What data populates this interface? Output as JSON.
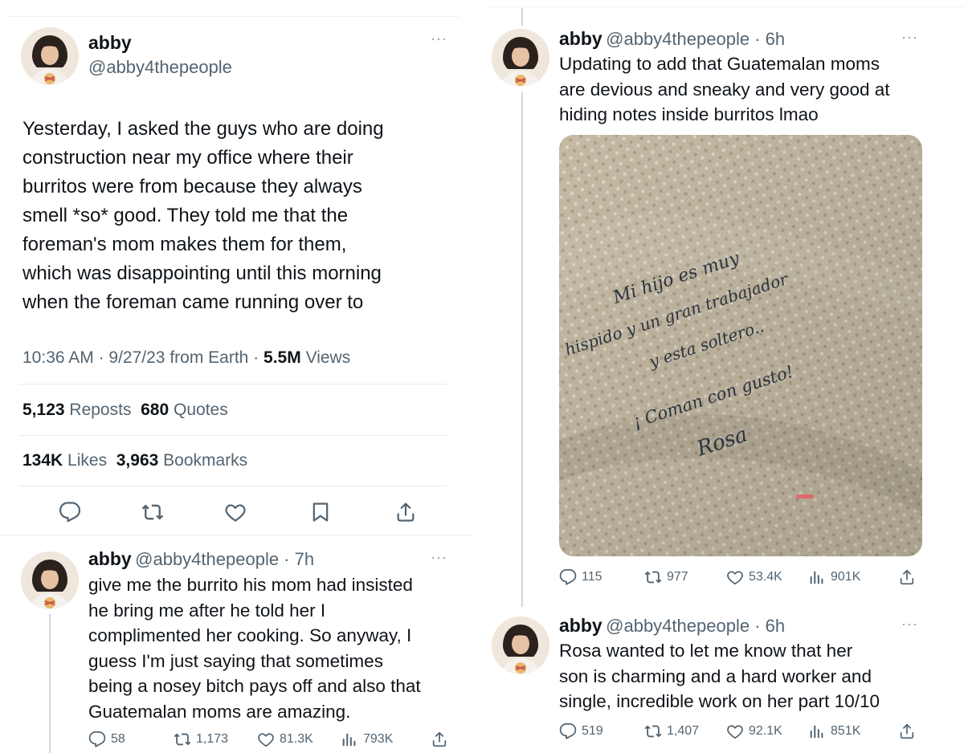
{
  "main_tweet": {
    "name": "abby",
    "handle": "@abby4thepeople",
    "more": "···",
    "text_lines": [
      "Yesterday, I asked the guys who are doing",
      "construction near my office where their",
      "burritos were from because they always",
      "smell *so* good. They told me that the",
      "foreman's mom makes them for them,",
      "which was disappointing until this morning",
      "when the foreman came running over to"
    ],
    "time": "10:36 AM",
    "date": "9/27/23",
    "source": "from Earth",
    "views_value": "5.5M",
    "views_label": "Views",
    "reposts_value": "5,123",
    "reposts_label": "Reposts",
    "quotes_value": "680",
    "quotes_label": "Quotes",
    "likes_value": "134K",
    "likes_label": "Likes",
    "bookmarks_value": "3,963",
    "bookmarks_label": "Bookmarks"
  },
  "reply_left": {
    "name": "abby",
    "handle": "@abby4thepeople",
    "age": "7h",
    "more": "···",
    "text_lines": [
      "give me the burrito his mom had insisted",
      "he bring me after he told her I",
      "complimented her cooking. So anyway, I",
      "guess I'm just saying that sometimes",
      "being a nosey bitch pays off and also that",
      "Guatemalan moms are amazing."
    ],
    "replies": "58",
    "reposts": "1,173",
    "likes": "81.3K",
    "views": "793K"
  },
  "reply_right_1": {
    "name": "abby",
    "handle": "@abby4thepeople",
    "age": "6h",
    "more": "···",
    "text_lines": [
      "Updating to add that Guatemalan moms",
      "are devious and sneaky and very good at",
      "hiding notes inside burritos lmao"
    ],
    "replies": "115",
    "reposts": "977",
    "likes": "53.4K",
    "views": "901K",
    "note": {
      "lines": [
        "Mi hijo es muy",
        "hispido y un gran trabajador",
        "y esta soltero..",
        "¡ Coman con gusto!",
        "Rosa"
      ]
    }
  },
  "reply_right_2": {
    "name": "abby",
    "handle": "@abby4thepeople",
    "age": "6h",
    "more": "···",
    "text_lines": [
      "Rosa wanted to let me know that her",
      "son is charming and a hard worker and",
      "single, incredible work on her part 10/10"
    ],
    "replies": "519",
    "reposts": "1,407",
    "likes": "92.1K",
    "views": "851K"
  },
  "icons": [
    "reply-icon",
    "repost-icon",
    "like-icon",
    "bookmark-icon",
    "share-icon",
    "views-icon",
    "more-icon"
  ],
  "colors": {
    "text": "#0f1419",
    "secondary": "#536471",
    "divider": "#e6ecf0",
    "thread": "#cfd9de"
  }
}
